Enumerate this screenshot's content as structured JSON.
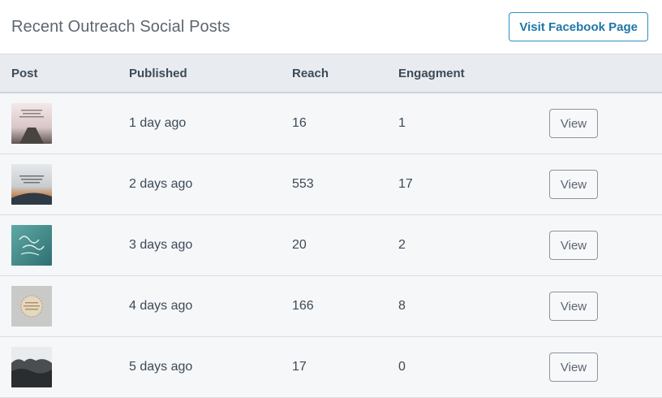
{
  "header": {
    "title": "Recent Outreach Social Posts",
    "facebook_button": "Visit Facebook Page"
  },
  "table": {
    "columns": [
      "Post",
      "Published",
      "Reach",
      "Engagment",
      ""
    ],
    "rows": [
      {
        "published": "1 day ago",
        "reach": "16",
        "engagement": "1",
        "action": "View"
      },
      {
        "published": "2 days ago",
        "reach": "553",
        "engagement": "17",
        "action": "View"
      },
      {
        "published": "3 days ago",
        "reach": "20",
        "engagement": "2",
        "action": "View"
      },
      {
        "published": "4 days ago",
        "reach": "166",
        "engagement": "8",
        "action": "View"
      },
      {
        "published": "5 days ago",
        "reach": "17",
        "engagement": "0",
        "action": "View"
      }
    ]
  },
  "colors": {
    "accent": "#2f8fbf",
    "header_bg": "#e8ecf0",
    "row_bg": "#f5f7f9"
  }
}
